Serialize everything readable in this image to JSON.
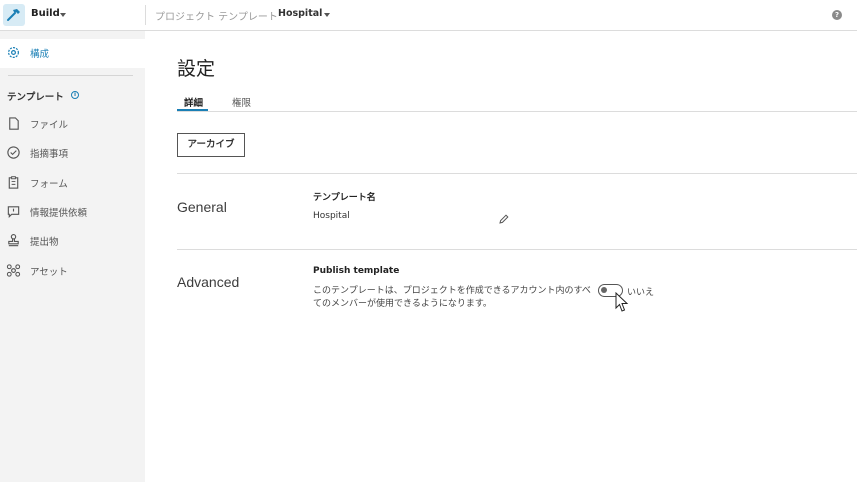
{
  "topbar": {
    "app_name": "Build",
    "crumb_label": "プロジェクト テンプレート",
    "crumb_value": "Hospital",
    "help": "?"
  },
  "sidebar": {
    "top_item": {
      "label": "構成",
      "icon": "gear-icon"
    },
    "heading": "テンプレート",
    "info": "i",
    "items": [
      {
        "label": "ファイル",
        "icon": "file-icon"
      },
      {
        "label": "指摘事項",
        "icon": "check-circle-icon"
      },
      {
        "label": "フォーム",
        "icon": "clipboard-icon"
      },
      {
        "label": "情報提供依頼",
        "icon": "chat-icon"
      },
      {
        "label": "提出物",
        "icon": "stamp-icon"
      },
      {
        "label": "アセット",
        "icon": "asset-icon"
      }
    ]
  },
  "main": {
    "title": "設定",
    "tabs": [
      {
        "label": "詳細",
        "active": true
      },
      {
        "label": "権限",
        "active": false
      }
    ],
    "archive_button": "アーカイブ",
    "general": {
      "section": "General",
      "field_label": "テンプレート名",
      "field_value": "Hospital"
    },
    "advanced": {
      "section": "Advanced",
      "field_label": "Publish template",
      "description": "このテンプレートは、プロジェクトを作成できるアカウント内のすべてのメンバーが使用できるようになります。",
      "toggle_state_label": "いいえ",
      "toggle_on": false
    }
  },
  "colors": {
    "accent": "#1a7fb5",
    "sidebar_bg": "#f3f3f3",
    "border": "#dcdcdc"
  }
}
